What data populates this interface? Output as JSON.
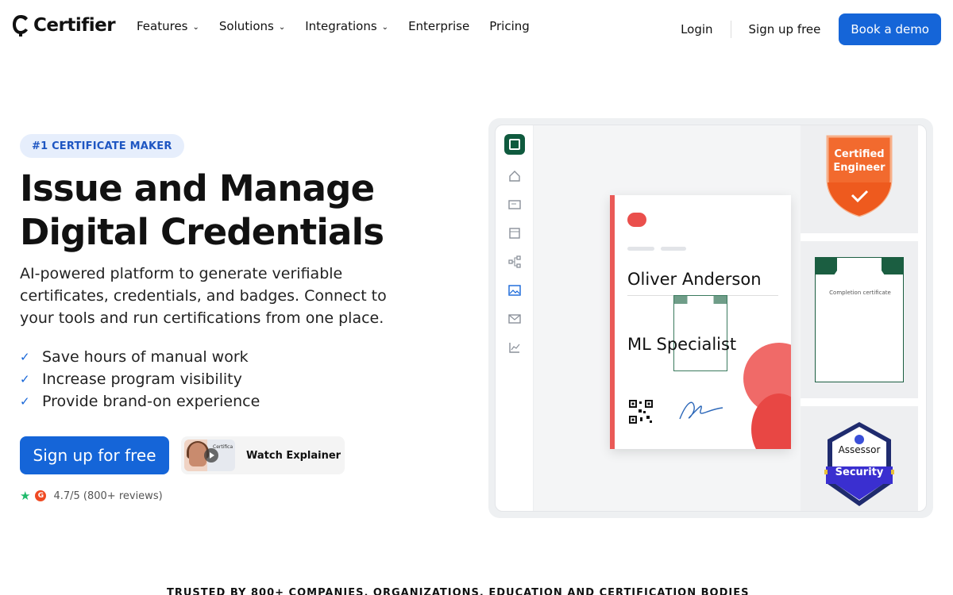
{
  "nav": {
    "brand": "Certifier",
    "links": [
      {
        "label": "Features",
        "dropdown": true
      },
      {
        "label": "Solutions",
        "dropdown": true
      },
      {
        "label": "Integrations",
        "dropdown": true
      },
      {
        "label": "Enterprise",
        "dropdown": false
      },
      {
        "label": "Pricing",
        "dropdown": false
      }
    ],
    "login": "Login",
    "signup": "Sign up free",
    "demo": "Book a demo"
  },
  "hero": {
    "badge": "#1 CERTIFICATE MAKER",
    "title_line1": "Issue and Manage",
    "title_line2": "Digital Credentials",
    "subtitle": "AI-powered platform to generate verifiable certificates, credentials, and badges. Connect to your tools and run certifications from one place.",
    "benefits": [
      "Save hours of manual work",
      "Increase program visibility",
      "Provide brand-on experience"
    ],
    "cta": "Sign up for free",
    "watch": "Watch Explainer",
    "watch_thumb_text": "Certifica",
    "rating": "4.7/5 (800+ reviews)"
  },
  "mockup": {
    "sidebar_icons": [
      "home-icon",
      "certificate-icon",
      "template-icon",
      "workflow-icon",
      "image-icon",
      "mail-icon",
      "analytics-icon"
    ],
    "certificate": {
      "recipient": "Oliver Anderson",
      "title": "ML Specialist",
      "mini_label": "Completion certificate"
    },
    "badges": {
      "certified_line1": "Certified",
      "certified_line2": "Engineer",
      "completion": "Completion certificate",
      "assessor": "Assessor",
      "security": "Security"
    },
    "colors": {
      "accent": "#1565d8",
      "brand_red": "#ea4f4c",
      "badge_orange": "#f26a2e",
      "hex_navy": "#1f2b6e",
      "cert_green": "#1b5e41"
    }
  },
  "footer_peek": "TRUSTED BY 800+ COMPANIES, ORGANIZATIONS, EDUCATION AND CERTIFICATION BODIES"
}
